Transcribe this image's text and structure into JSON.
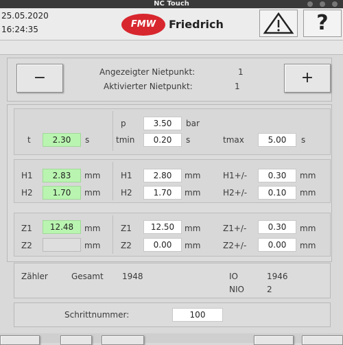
{
  "window": {
    "title": "NC Touch"
  },
  "header": {
    "date": "25.05.2020",
    "time": "16:24:35",
    "logo_mark": "FMW",
    "logo_name": "Friedrich",
    "warning_icon": "warning-icon",
    "help_label": "?"
  },
  "rivet": {
    "minus_label": "−",
    "plus_label": "+",
    "displayed_label": "Angezeigter Nietpunkt:",
    "displayed_value": "1",
    "activated_label": "Aktivierter Nietpunkt:",
    "activated_value": "1"
  },
  "pressure": {
    "t_label": "t",
    "t_value": "2.30",
    "t_unit": "s",
    "p_label": "p",
    "p_value": "3.50",
    "p_unit": "bar",
    "tmin_label": "tmin",
    "tmin_value": "0.20",
    "tmin_unit": "s",
    "tmax_label": "tmax",
    "tmax_value": "5.00",
    "tmax_unit": "s"
  },
  "heights": {
    "h1_label": "H1",
    "h1_actual": "2.83",
    "h2_label": "H2",
    "h2_actual": "1.70",
    "unit": "mm",
    "h1_set": "2.80",
    "h2_set": "1.70",
    "h1_tol_label": "H1+/-",
    "h1_tol": "0.30",
    "h2_tol_label": "H2+/-",
    "h2_tol": "0.10"
  },
  "z": {
    "z1_label": "Z1",
    "z1_actual": "12.48",
    "z2_label": "Z2",
    "z2_actual": "",
    "unit": "mm",
    "z1_set": "12.50",
    "z2_set": "0.00",
    "z1_tol_label": "Z1+/-",
    "z1_tol": "0.30",
    "z2_tol_label": "Z2+/-",
    "z2_tol": "0.00"
  },
  "counter": {
    "label": "Zähler",
    "total_label": "Gesamt",
    "total_value": "1948",
    "io_label": "IO",
    "io_value": "1946",
    "nio_label": "NIO",
    "nio_value": "2"
  },
  "step": {
    "label": "Schrittnummer:",
    "value": "100"
  },
  "colors": {
    "accent_green": "#b9f5b0",
    "logo_red": "#d8262e"
  }
}
